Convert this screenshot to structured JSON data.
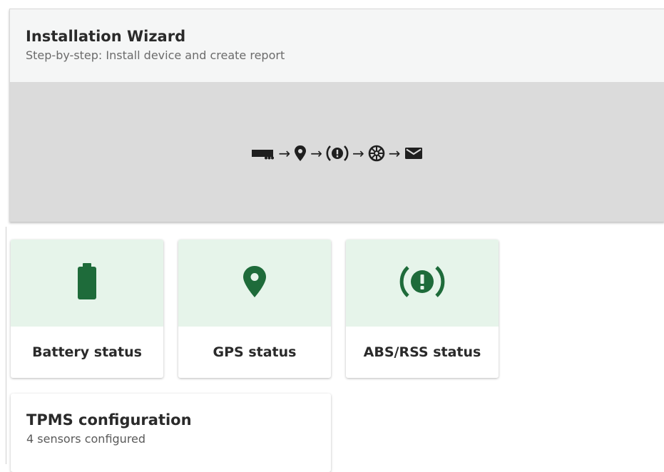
{
  "wizard": {
    "title": "Installation Wizard",
    "subtitle": "Step-by-step: Install device and create report",
    "steps": [
      {
        "icon": "truck-icon"
      },
      {
        "icon": "location-pin-icon"
      },
      {
        "icon": "brake-warning-icon"
      },
      {
        "icon": "tire-wheel-icon"
      },
      {
        "icon": "envelope-icon"
      }
    ],
    "arrow": "→"
  },
  "cards": [
    {
      "label": "Battery status",
      "icon": "battery-icon"
    },
    {
      "label": "GPS status",
      "icon": "location-pin-icon"
    },
    {
      "label": "ABS/RSS status",
      "icon": "brake-warning-icon"
    }
  ],
  "tpms": {
    "title": "TPMS configuration",
    "subtitle": "4 sensors configured"
  },
  "colors": {
    "accent": "#1e6b3a",
    "card_top_bg": "#e6f4ea",
    "banner_bg": "#dbdbdb",
    "header_bg": "#f5f6f6",
    "text_dark": "#2a2a2a",
    "text_muted": "#6b6b6b"
  }
}
